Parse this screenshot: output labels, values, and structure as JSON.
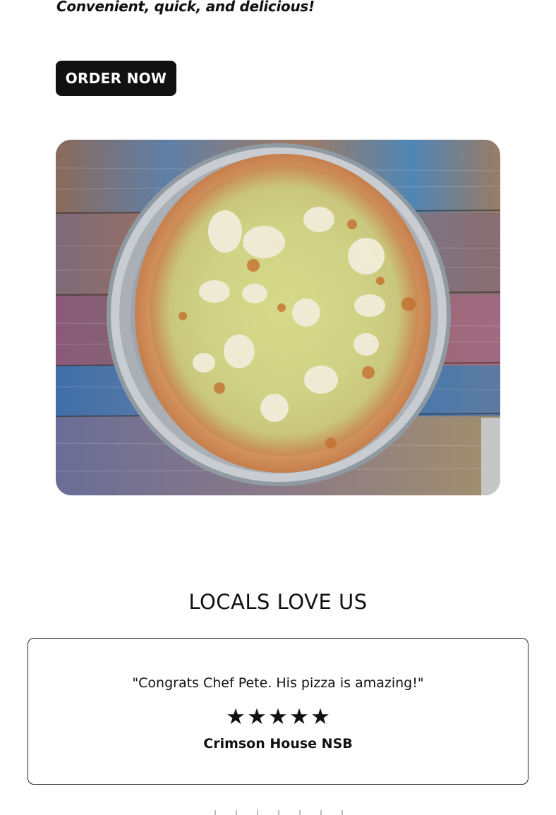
{
  "hero": {
    "tagline": "Convenient, quick, and delicious!",
    "order_button_label": "ORDER NOW",
    "image_alt": "Pizza"
  },
  "testimonials": {
    "section_title": "LOCALS LOVE US",
    "reviews": [
      {
        "quote": "\"Congrats Chef Pete. His pizza is amazing!\"",
        "rating": 5,
        "rating_max": 5,
        "reviewer": "Crimson House NSB"
      }
    ]
  },
  "colors": {
    "text": "#111111",
    "button_bg": "#111111",
    "button_text": "#ffffff",
    "card_border": "#222222"
  },
  "icons": {
    "star": "star-icon"
  }
}
